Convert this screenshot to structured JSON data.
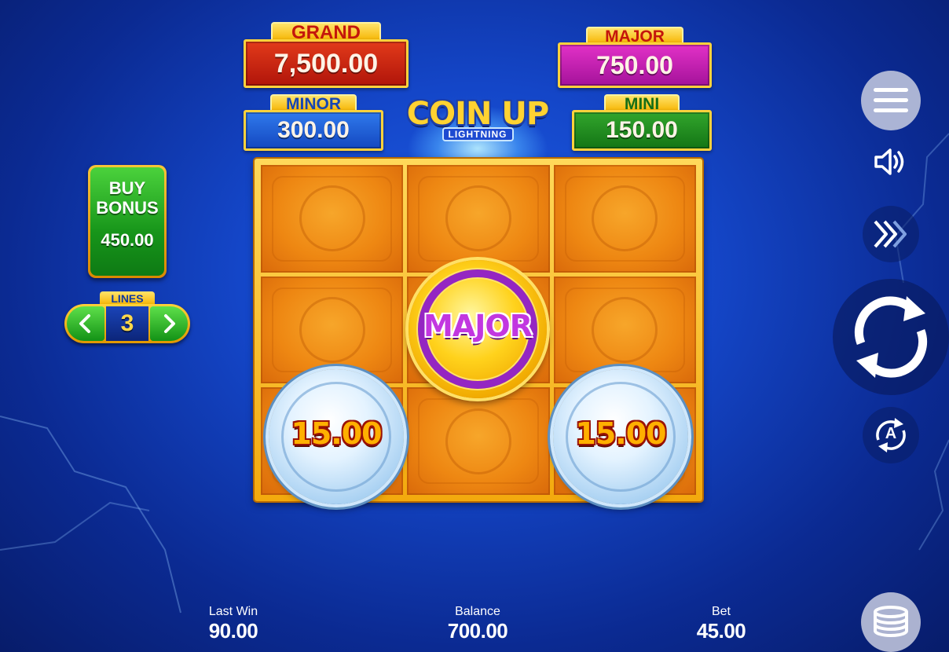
{
  "jackpots": {
    "grand": {
      "label": "GRAND",
      "value": "7,500.00",
      "color": "#c4190a"
    },
    "major": {
      "label": "MAJOR",
      "value": "750.00",
      "color": "#c21bb0"
    },
    "minor": {
      "label": "MINOR",
      "value": "300.00",
      "color": "#1b5fd6"
    },
    "mini": {
      "label": "MINI",
      "value": "150.00",
      "color": "#1e8a1c"
    }
  },
  "logo": {
    "main": "COIN UP",
    "sub": "LIGHTNING"
  },
  "buy_bonus": {
    "title_line1": "BUY",
    "title_line2": "BONUS",
    "price": "450.00"
  },
  "lines": {
    "label": "LINES",
    "value": "3"
  },
  "reels": {
    "coins": [
      {
        "type": "jackpot",
        "label": "MAJOR"
      },
      {
        "type": "value",
        "label": "15.00"
      },
      {
        "type": "value",
        "label": "15.00"
      }
    ]
  },
  "controls": {
    "menu_icon": "hamburger-icon",
    "sound_icon": "speaker-icon",
    "turbo_icon": "fast-forward-icon",
    "spin_icon": "spin-arrows-icon",
    "auto_icon": "autoplay-icon",
    "auto_letter": "A",
    "bet_icon": "coin-stack-icon"
  },
  "stats": {
    "last_win": {
      "label": "Last Win",
      "value": "90.00"
    },
    "balance": {
      "label": "Balance",
      "value": "700.00"
    },
    "bet": {
      "label": "Bet",
      "value": "45.00"
    }
  }
}
